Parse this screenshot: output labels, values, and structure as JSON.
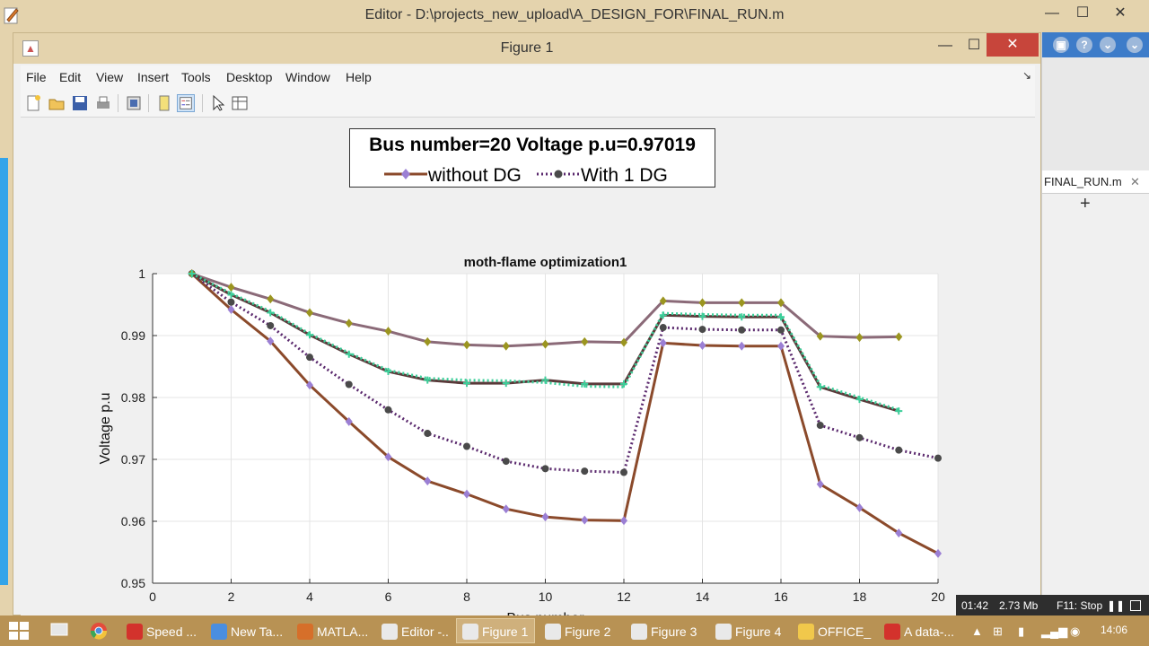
{
  "editor": {
    "title": "Editor - D:\\projects_new_upload\\A_DESIGN_FOR\\FINAL_RUN.m",
    "min_label": "—",
    "max_label": "☐",
    "close_label": "✕"
  },
  "right_panel": {
    "tab_label": "FINAL_RUN.m",
    "tab_close": "✕",
    "plus_label": "+",
    "collapse_label": "⌅"
  },
  "figure_window": {
    "title": "Figure 1",
    "min_label": "—",
    "max_label": "☐",
    "close_label": "✕"
  },
  "menu": {
    "items": [
      "File",
      "Edit",
      "View",
      "Insert",
      "Tools",
      "Desktop",
      "Window",
      "Help"
    ],
    "arrow": "↘"
  },
  "toolbar": {
    "icons": [
      "new-figure-icon",
      "open-file-icon",
      "save-icon",
      "print-icon",
      "print-preview-icon",
      "link-plot-icon",
      "toggle-legend-icon",
      "edit-plot-icon",
      "property-inspector-icon"
    ]
  },
  "legend": {
    "title": "Bus number=20  Voltage p.u=0.97019",
    "entries": [
      "without DG",
      "With 1  DG"
    ]
  },
  "chart_data": {
    "type": "line",
    "title": "moth-flame optimization1",
    "xlabel": "Bus number",
    "ylabel": "Voltage p.u",
    "xlim": [
      0,
      20
    ],
    "ylim": [
      0.95,
      1
    ],
    "xticks": [
      0,
      2,
      4,
      6,
      8,
      10,
      12,
      14,
      16,
      18,
      20
    ],
    "yticks": [
      0.95,
      0.96,
      0.97,
      0.98,
      0.99,
      1
    ],
    "ytick_labels": [
      "0.95",
      "0.96",
      "0.97",
      "0.98",
      "0.99",
      "1"
    ],
    "grid": true,
    "series": [
      {
        "name": "without DG",
        "color": "#8b4a2b",
        "marker_color": "#9b7fd4",
        "marker": "diamond",
        "dash": "solid",
        "x": [
          1,
          2,
          3,
          4,
          5,
          6,
          7,
          8,
          9,
          10,
          11,
          12,
          13,
          14,
          15,
          16,
          17,
          18,
          19,
          20
        ],
        "y": [
          1.0,
          0.9942,
          0.9891,
          0.982,
          0.9761,
          0.9704,
          0.9665,
          0.9644,
          0.962,
          0.9607,
          0.9602,
          0.9601,
          0.9888,
          0.9884,
          0.9883,
          0.9883,
          0.966,
          0.9622,
          0.9581,
          0.9548
        ]
      },
      {
        "name": "With 1  DG",
        "color": "#5b2a6e",
        "marker_color": "#4a4a4a",
        "marker": "circle",
        "dash": "dotted",
        "x": [
          1,
          2,
          3,
          4,
          5,
          6,
          7,
          8,
          9,
          10,
          11,
          12,
          13,
          14,
          15,
          16,
          17,
          18,
          19,
          20
        ],
        "y": [
          1.0,
          0.9954,
          0.9916,
          0.9865,
          0.9821,
          0.978,
          0.9742,
          0.9721,
          0.9697,
          0.9685,
          0.9681,
          0.9679,
          0.9913,
          0.991,
          0.9909,
          0.9909,
          0.9755,
          0.9735,
          0.9715,
          0.9702
        ]
      },
      {
        "color": "#8b6a78",
        "marker_color": "#9b9520",
        "marker": "diamond",
        "dash": "solid",
        "x": [
          1,
          2,
          3,
          4,
          5,
          6,
          7,
          8,
          9,
          10,
          11,
          12,
          13,
          14,
          15,
          16,
          17,
          18,
          19
        ],
        "y": [
          1.0,
          0.9978,
          0.9959,
          0.9937,
          0.992,
          0.9907,
          0.989,
          0.9885,
          0.9883,
          0.9886,
          0.989,
          0.9889,
          0.9956,
          0.9953,
          0.9953,
          0.9953,
          0.9899,
          0.9897,
          0.9898
        ]
      },
      {
        "color": "#5a3a3a",
        "marker_color": "#3ccf9a",
        "marker": "plus",
        "dash": "solid",
        "x": [
          1,
          2,
          3,
          4,
          5,
          6,
          7,
          8,
          9,
          10,
          11,
          12,
          13,
          14,
          15,
          16,
          17,
          18,
          19
        ],
        "y": [
          1.0,
          0.9966,
          0.9937,
          0.9901,
          0.987,
          0.9842,
          0.9828,
          0.9823,
          0.9823,
          0.9828,
          0.9822,
          0.9822,
          0.9933,
          0.9931,
          0.993,
          0.993,
          0.9817,
          0.9797,
          0.9778
        ]
      },
      {
        "color": "#3ccf9a",
        "marker_color": "#3ccf9a",
        "marker": "none",
        "dash": "dotted",
        "x": [
          1,
          2,
          3,
          4,
          5,
          6,
          7,
          8,
          9,
          10,
          11,
          12,
          13,
          14,
          15,
          16,
          17,
          18,
          19
        ],
        "y": [
          1.0,
          0.9968,
          0.9939,
          0.9903,
          0.9872,
          0.9844,
          0.9831,
          0.9828,
          0.9827,
          0.9824,
          0.9818,
          0.9817,
          0.9936,
          0.9934,
          0.9933,
          0.9933,
          0.982,
          0.98,
          0.978
        ]
      }
    ]
  },
  "status": {
    "time": "01:42",
    "memory": "2.73 Mb",
    "stop": "F11: Stop",
    "pause": "❚❚"
  },
  "taskbar": {
    "tasks": [
      {
        "label": "Speed ...",
        "color": "#d3322c",
        "active": false
      },
      {
        "label": "New Ta...",
        "color": "#4a8ee0",
        "active": false
      },
      {
        "label": "MATLA...",
        "color": "#d66f2a",
        "active": false
      },
      {
        "label": "Editor -...",
        "color": "#e9e9e9",
        "active": false
      },
      {
        "label": "Figure 1",
        "color": "#e9e9e9",
        "active": true
      },
      {
        "label": "Figure 2",
        "color": "#e9e9e9",
        "active": false
      },
      {
        "label": "Figure 3",
        "color": "#e9e9e9",
        "active": false
      },
      {
        "label": "Figure 4",
        "color": "#e9e9e9",
        "active": false
      },
      {
        "label": "OFFICE_...",
        "color": "#f1c84b",
        "active": false
      },
      {
        "label": "A data-...",
        "color": "#d3322c",
        "active": false
      }
    ],
    "clock": "14:06"
  }
}
